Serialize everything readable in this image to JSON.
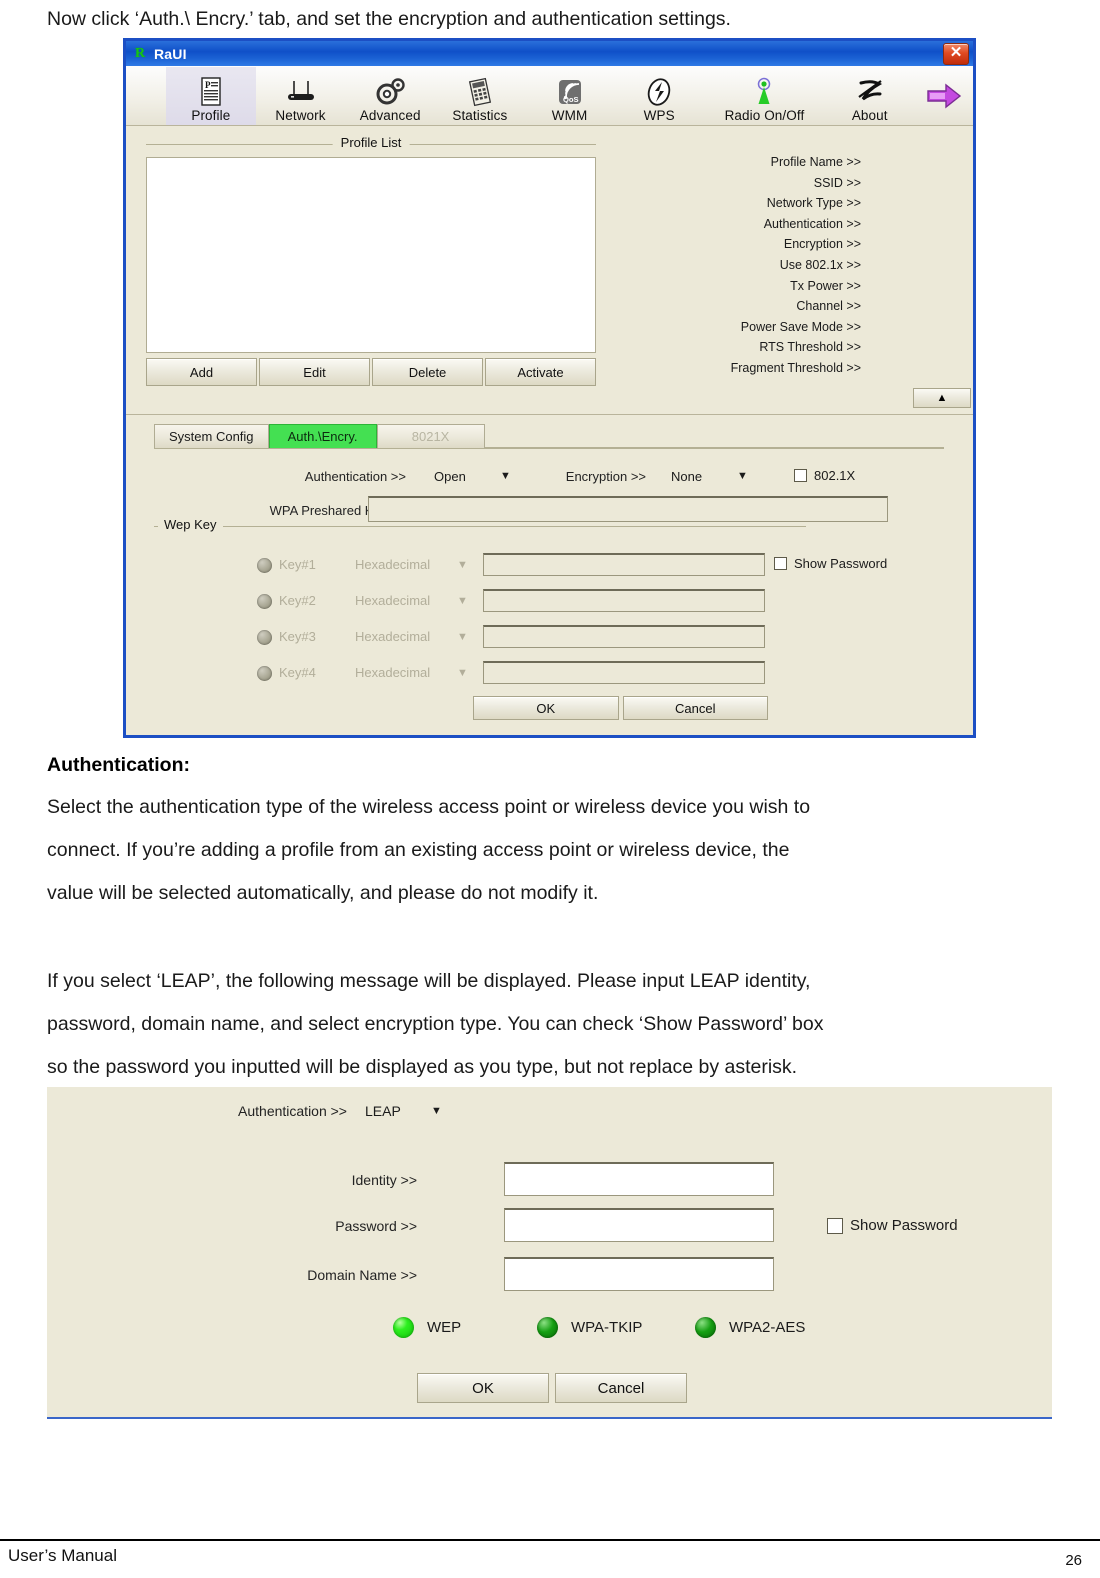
{
  "document": {
    "intro_line": "Now click ‘Auth.\\ Encry.’ tab, and set the encryption and authentication settings.",
    "section_heading": "Authentication:",
    "paragraph1": [
      "Select the authentication type of the wireless access point or wireless device you wish to",
      "connect. If you’re adding a profile from an existing access point or wireless device, the",
      "value will be selected automatically, and please do not modify it."
    ],
    "paragraph2": [
      "If you select ‘LEAP’, the following message will be displayed. Please input LEAP identity,",
      "password, domain name, and select encryption type. You can check ‘Show Password’ box",
      "so the password you inputted will be displayed as you type, but not replace by asterisk."
    ],
    "footer_left": "User’s Manual",
    "footer_page": "26"
  },
  "raui": {
    "title": "RaUI",
    "title_icon": "R",
    "close_label": "✕",
    "toolbar": [
      {
        "label": "Profile",
        "icon": "profile-icon",
        "selected": true
      },
      {
        "label": "Network",
        "icon": "network-icon",
        "selected": false
      },
      {
        "label": "Advanced",
        "icon": "advanced-icon",
        "selected": false
      },
      {
        "label": "Statistics",
        "icon": "statistics-icon",
        "selected": false
      },
      {
        "label": "WMM",
        "icon": "wmm-qos-icon",
        "selected": false
      },
      {
        "label": "WPS",
        "icon": "wps-icon",
        "selected": false
      },
      {
        "label": "Radio On/Off",
        "icon": "radio-onoff-icon",
        "selected": false
      },
      {
        "label": "About",
        "icon": "about-icon",
        "selected": false
      }
    ],
    "toolbar_more_icon": "purple-arrow-icon",
    "profile_list": {
      "title": "Profile List",
      "rows": [],
      "buttons": [
        "Add",
        "Edit",
        "Delete",
        "Activate"
      ]
    },
    "properties": [
      "Profile Name >>",
      "SSID >>",
      "Network Type >>",
      "Authentication >>",
      "Encryption >>",
      "Use 802.1x >>",
      "Tx Power >>",
      "Channel >>",
      "Power Save Mode >>",
      "RTS Threshold >>",
      "Fragment Threshold >>"
    ],
    "collapse_icon": "▲",
    "tabs": [
      {
        "label": "System Config",
        "state": "normal"
      },
      {
        "label": "Auth.\\Encry.",
        "state": "active"
      },
      {
        "label": "8021X",
        "state": "disabled"
      }
    ],
    "auth_row": {
      "auth_label": "Authentication >>",
      "auth_value": "Open",
      "encryption_label": "Encryption >>",
      "encryption_value": "None",
      "dot1x_label": "802.1X",
      "dot1x_checked": false,
      "carat": "▼"
    },
    "wpa_psk": {
      "label": "WPA Preshared Key >>",
      "value": ""
    },
    "wep_key": {
      "group_title": "Wep Key",
      "show_password_label": "Show Password",
      "show_password_checked": false,
      "rows": [
        {
          "name": "Key#1",
          "format": "Hexadecimal",
          "value": ""
        },
        {
          "name": "Key#2",
          "format": "Hexadecimal",
          "value": ""
        },
        {
          "name": "Key#3",
          "format": "Hexadecimal",
          "value": ""
        },
        {
          "name": "Key#4",
          "format": "Hexadecimal",
          "value": ""
        }
      ]
    },
    "dialog_buttons": {
      "ok": "OK",
      "cancel": "Cancel"
    }
  },
  "leap_dialog": {
    "auth_label": "Authentication >>",
    "auth_value": "LEAP",
    "carat": "▼",
    "fields": [
      {
        "label": "Identity >>",
        "value": ""
      },
      {
        "label": "Password >>",
        "value": ""
      },
      {
        "label": "Domain Name >>",
        "value": ""
      }
    ],
    "show_password_label": "Show Password",
    "show_password_checked": false,
    "encryption_options": [
      {
        "label": "WEP",
        "selected": true
      },
      {
        "label": "WPA-TKIP",
        "selected": false
      },
      {
        "label": "WPA2-AES",
        "selected": false
      }
    ],
    "buttons": {
      "ok": "OK",
      "cancel": "Cancel"
    }
  },
  "colors": {
    "titlebar_blue": "#1c4fc4",
    "window_face": "#ece9d8",
    "active_tab_green": "#44e052",
    "close_red": "#c12d0c",
    "led_green": "#2ef01f"
  }
}
